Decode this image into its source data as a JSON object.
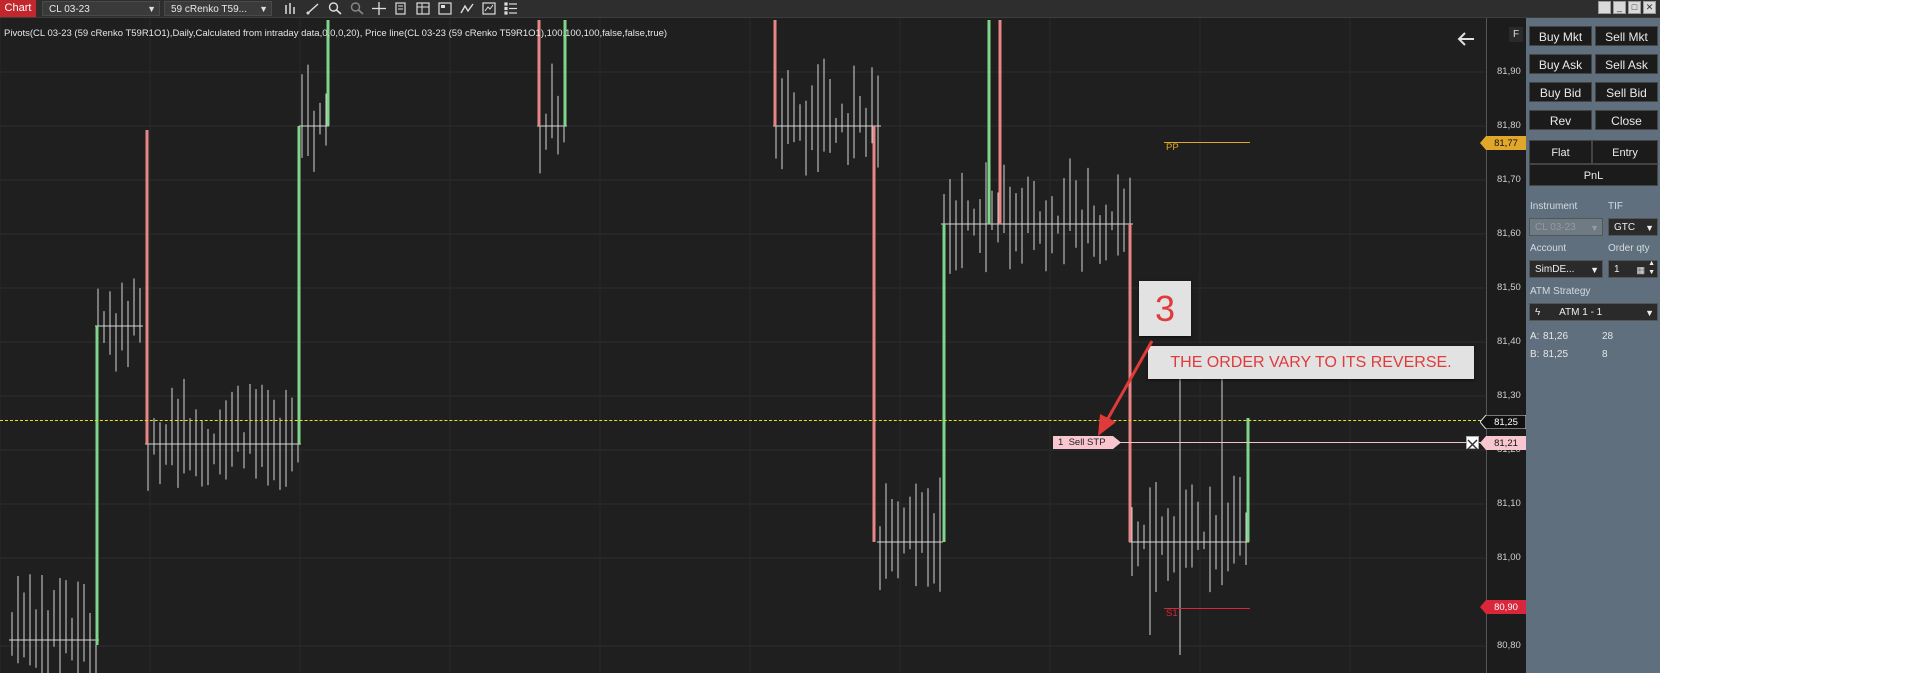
{
  "toolbar": {
    "title": "Chart",
    "instrument": "CL 03-23",
    "bar_type": "59 cRenko T59...",
    "window_buttons": [
      "_",
      "□",
      "✕"
    ]
  },
  "indicator_text": "Pivots(CL 03-23 (59 cRenko T59R1O1),Daily,Calculated from intraday data,0,0,0,20), Price line(CL 03-23 (59 cRenko T59R1O1),100,100,100,false,false,true)",
  "price_axis": {
    "ticks": [
      "81,90",
      "81,80",
      "81,70",
      "81,60",
      "81,50",
      "81,40",
      "81,30",
      "81,20",
      "81,10",
      "81,00",
      "80,80"
    ],
    "tags": {
      "pp": "81,77",
      "last": "81,25",
      "order": "81,21",
      "s1": "80,90"
    },
    "strip_label": "F"
  },
  "levels": {
    "pp_label": "PP",
    "s1_label": "S1"
  },
  "order": {
    "qty": "1",
    "type": "Sell STP"
  },
  "annotation": {
    "number": "3",
    "text": "THE ORDER VARY TO ITS REVERSE."
  },
  "panel": {
    "buy_mkt": "Buy Mkt",
    "sell_mkt": "Sell Mkt",
    "buy_ask": "Buy Ask",
    "sell_ask": "Sell Ask",
    "buy_bid": "Buy Bid",
    "sell_bid": "Sell Bid",
    "rev": "Rev",
    "close": "Close",
    "flat": "Flat",
    "entry": "Entry",
    "pnl": "PnL",
    "instrument_label": "Instrument",
    "tif_label": "TIF",
    "instrument_value": "CL 03-23",
    "tif_value": "GTC",
    "account_label": "Account",
    "order_qty_label": "Order qty",
    "account_value": "SimDE...",
    "order_qty_value": "1",
    "atm_label": "ATM Strategy",
    "atm_value": "ATM 1 - 1",
    "ask_label": "A:",
    "ask_price": "81,26",
    "ask_size": "28",
    "bid_label": "B:",
    "bid_price": "81,25",
    "bid_size": "8"
  },
  "colors": {
    "up": "#7fd68a",
    "down": "#e88686",
    "neutral": "#d6d6d6",
    "pp": "#e0a72a",
    "s1": "#d9263a",
    "price_line": "#e6e22a",
    "order_line": "#f2c2cb"
  }
}
